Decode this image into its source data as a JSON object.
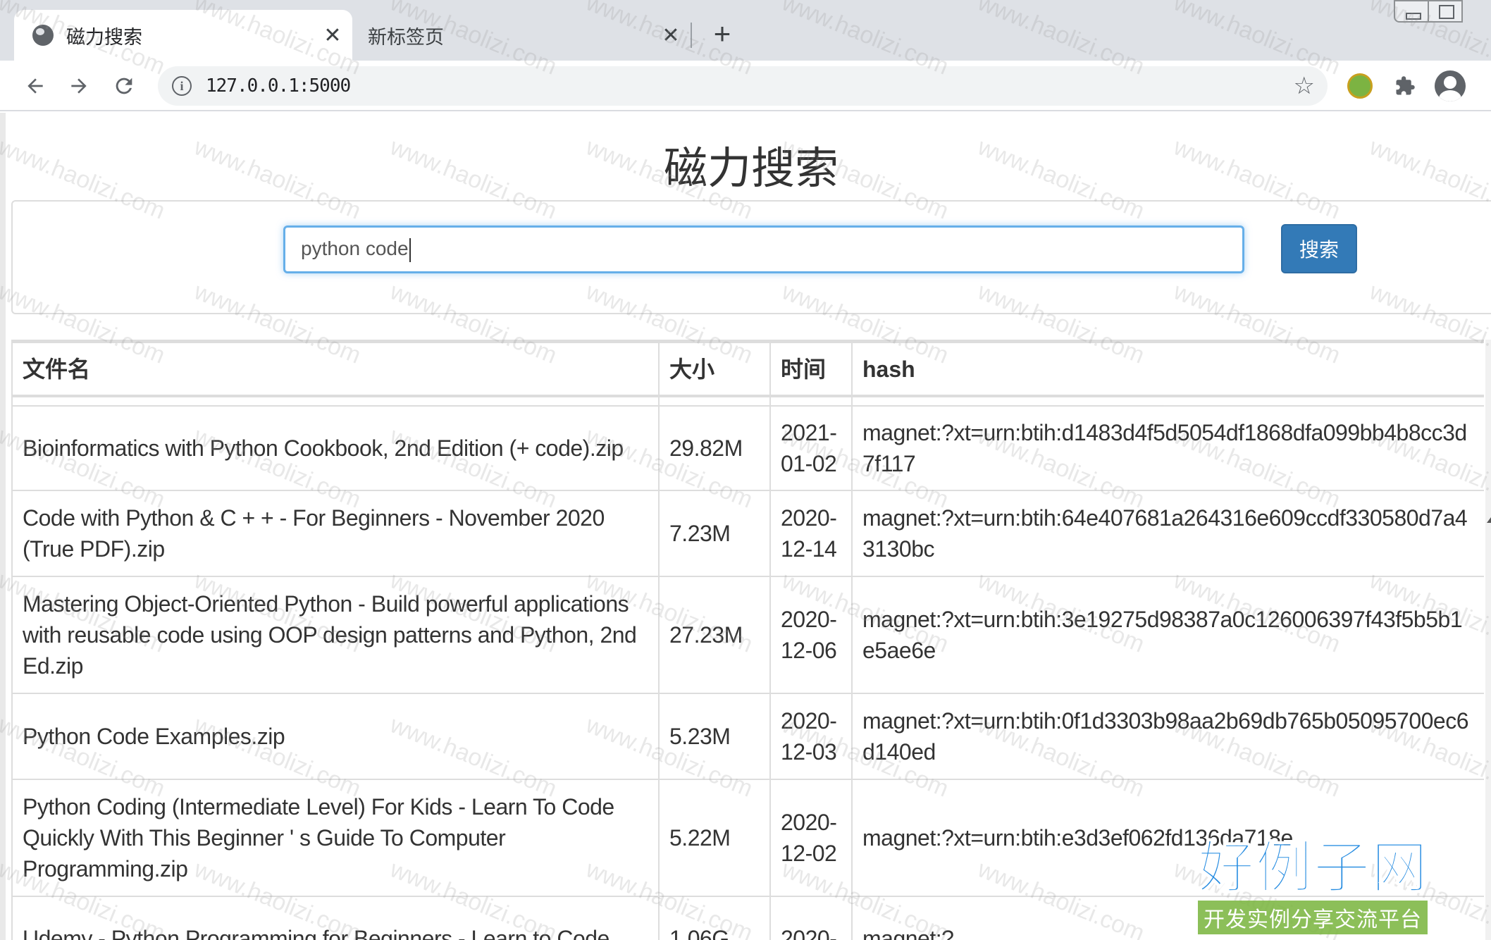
{
  "browser": {
    "tabs": [
      {
        "title": "磁力搜索",
        "active": true,
        "close": "✕"
      },
      {
        "title": "新标签页",
        "active": false,
        "close": "✕"
      }
    ],
    "new_tab": "+",
    "url": "127.0.0.1:5000",
    "icons": {
      "back": "arrow-left-icon",
      "forward": "arrow-right-icon",
      "reload": "reload-icon",
      "info": "info-icon",
      "bookmark": "star-icon",
      "extension_coin": "coin-extension-icon",
      "extensions": "puzzle-icon",
      "profile": "account-icon"
    }
  },
  "page": {
    "title": "磁力搜索",
    "search": {
      "value": "python code",
      "button_label": "搜索"
    },
    "table": {
      "headers": [
        "文件名",
        "大小",
        "时间",
        "hash"
      ],
      "rows": [
        {
          "name": "Bioinformatics with Python Cookbook, 2nd Edition (+ code).zip",
          "size": "29.82M",
          "time": "2021-01-02",
          "hash": "magnet:?xt=urn:btih:d1483d4f5d5054df1868dfa099bb4b8cc3d7f117"
        },
        {
          "name": "Code with Python & C + + - For Beginners - November 2020 (True PDF).zip",
          "size": "7.23M",
          "time": "2020-12-14",
          "hash": "magnet:?xt=urn:btih:64e407681a264316e609ccdf330580d7a43130bc"
        },
        {
          "name": "Mastering Object-Oriented Python - Build powerful applications with reusable code using OOP design patterns and Python, 2nd Ed.zip",
          "size": "27.23M",
          "time": "2020-12-06",
          "hash": "magnet:?xt=urn:btih:3e19275d98387a0c126006397f43f5b5b1e5ae6e"
        },
        {
          "name": "Python Code Examples.zip",
          "size": "5.23M",
          "time": "2020-12-03",
          "hash": "magnet:?xt=urn:btih:0f1d3303b98aa2b69db765b05095700ec6d140ed"
        },
        {
          "name": "Python Coding (Intermediate Level) For Kids - Learn To Code Quickly With This Beginner ' s Guide To Computer Programming.zip",
          "size": "5.22M",
          "time": "2020-12-02",
          "hash": "magnet:?xt=urn:btih:e3d3ef062fd136da718e"
        },
        {
          "name": "Udemy - Python Programming for Beginners - Learn to Code",
          "size": "1.06G",
          "time": "2020-",
          "hash": "magnet:?"
        }
      ]
    }
  },
  "watermark": {
    "text": "www.haolizi.com",
    "brand_big": "好例子网",
    "brand_small": "开发实例分享交流平台"
  },
  "colors": {
    "primary_button": "#337ab7",
    "input_focus": "#66afe9",
    "tabstrip": "#dee1e6"
  }
}
